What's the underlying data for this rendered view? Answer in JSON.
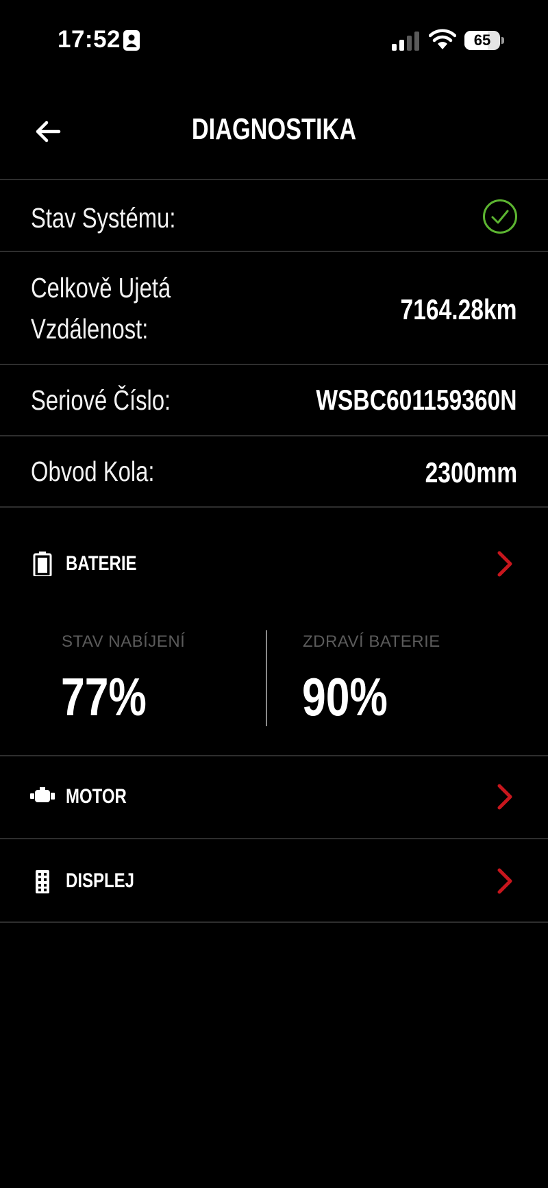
{
  "status_bar": {
    "time": "17:52",
    "battery_percent": "65",
    "battery_level": 0.65
  },
  "header": {
    "title": "DIAGNOSTIKA"
  },
  "info_rows": {
    "system_status": {
      "label": "Stav Systému:",
      "status": "ok"
    },
    "total_distance": {
      "label_line1": "Celkově Ujetá",
      "label_line2": "Vzdálenost:",
      "value": "7164.28km"
    },
    "serial_number": {
      "label": "Seriové Číslo:",
      "value": "WSBC601159360N"
    },
    "wheel_circumference": {
      "label": "Obvod Kola:",
      "value": "2300mm"
    }
  },
  "sections": {
    "battery": {
      "label": "BATERIE",
      "charge_label": "STAV NABÍJENÍ",
      "charge_value": "77%",
      "health_label": "ZDRAVÍ BATERIE",
      "health_value": "90%"
    },
    "motor": {
      "label": "MOTOR"
    },
    "display": {
      "label": "DISPLEJ"
    }
  },
  "colors": {
    "background": "#000000",
    "accent_red": "#c8161d",
    "ok_green": "#5cb531",
    "divider": "#2e2e2e",
    "muted_text": "#5b5b5b"
  },
  "icons": [
    "focus-mode-icon",
    "cellular-signal-icon",
    "wifi-icon",
    "battery-status-icon",
    "back-arrow-icon",
    "check-circle-icon",
    "battery-icon",
    "motor-icon",
    "display-icon",
    "chevron-right-icon"
  ]
}
